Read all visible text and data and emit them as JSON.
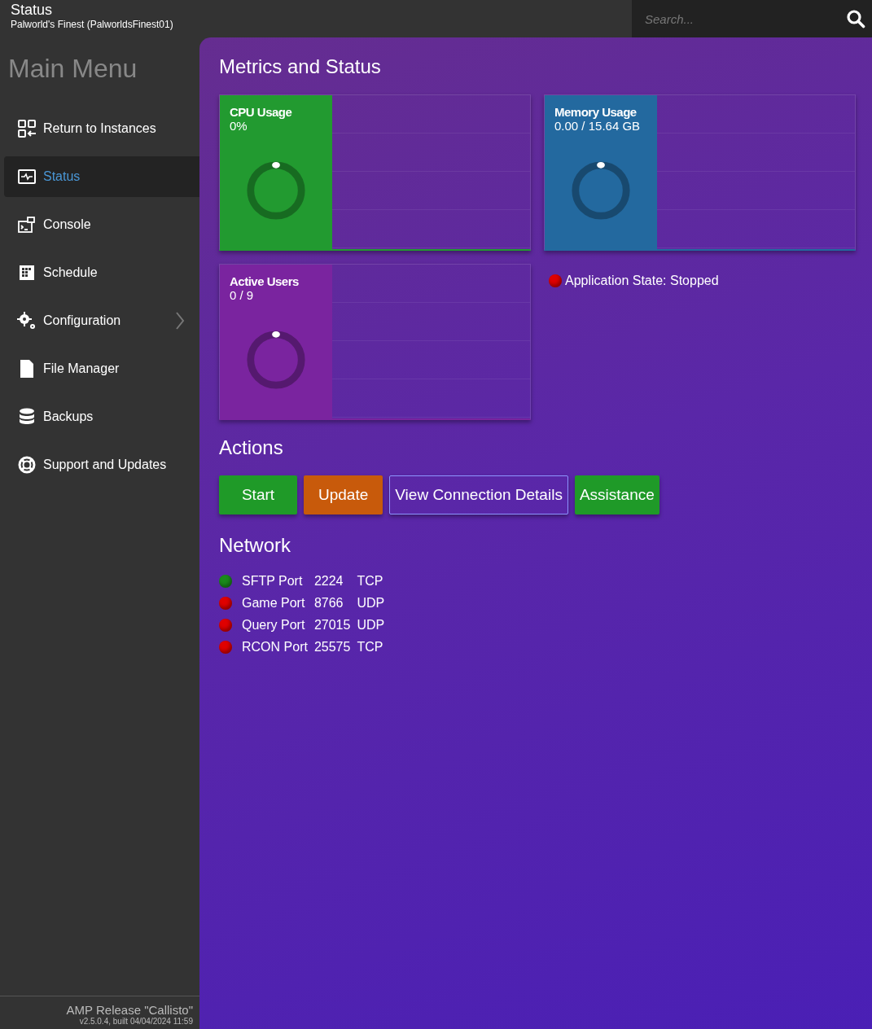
{
  "header": {
    "title": "Status",
    "subtitle": "Palworld's Finest (PalworldsFinest01)",
    "search": {
      "placeholder": "Search..."
    }
  },
  "sidebar": {
    "title": "Main Menu",
    "items": [
      {
        "label": "Return to Instances",
        "kind": "instances",
        "selected": false,
        "expandable": false
      },
      {
        "label": "Status",
        "kind": "status",
        "selected": true,
        "expandable": false
      },
      {
        "label": "Console",
        "kind": "console",
        "selected": false,
        "expandable": false
      },
      {
        "label": "Schedule",
        "kind": "schedule",
        "selected": false,
        "expandable": false
      },
      {
        "label": "Configuration",
        "kind": "config",
        "selected": false,
        "expandable": true
      },
      {
        "label": "File Manager",
        "kind": "file",
        "selected": false,
        "expandable": false
      },
      {
        "label": "Backups",
        "kind": "backups",
        "selected": false,
        "expandable": false
      },
      {
        "label": "Support and Updates",
        "kind": "support",
        "selected": false,
        "expandable": false
      }
    ],
    "footer": {
      "release": "AMP Release \"Callisto\"",
      "build": "v2.5.0.4, built 04/04/2024 11:59"
    }
  },
  "metrics": {
    "title": "Metrics and Status",
    "tiles": [
      {
        "label": "CPU Usage",
        "value": "0%",
        "color": "#229a30"
      },
      {
        "label": "Memory Usage",
        "value": "0.00 / 15.64 GB",
        "color": "#23699f"
      },
      {
        "label": "Active Users",
        "value": "0 / 9",
        "color": "#7a249f"
      }
    ],
    "app_state": {
      "text": "Application State: Stopped",
      "color": "#e00000"
    }
  },
  "actions": {
    "title": "Actions",
    "buttons": [
      {
        "label": "Start",
        "kind": "success"
      },
      {
        "label": "Update",
        "kind": "warning"
      },
      {
        "label": "View Connection Details",
        "kind": "outline"
      },
      {
        "label": "Assistance",
        "kind": "success"
      }
    ]
  },
  "network": {
    "title": "Network",
    "ports": [
      {
        "name": "SFTP Port",
        "port": "2224",
        "protocol": "TCP",
        "color": "#1a8a1a"
      },
      {
        "name": "Game Port",
        "port": "8766",
        "protocol": "UDP",
        "color": "#e00000"
      },
      {
        "name": "Query Port",
        "port": "27015",
        "protocol": "UDP",
        "color": "#e00000"
      },
      {
        "name": "RCON Port",
        "port": "25575",
        "protocol": "TCP",
        "color": "#e00000"
      }
    ]
  }
}
